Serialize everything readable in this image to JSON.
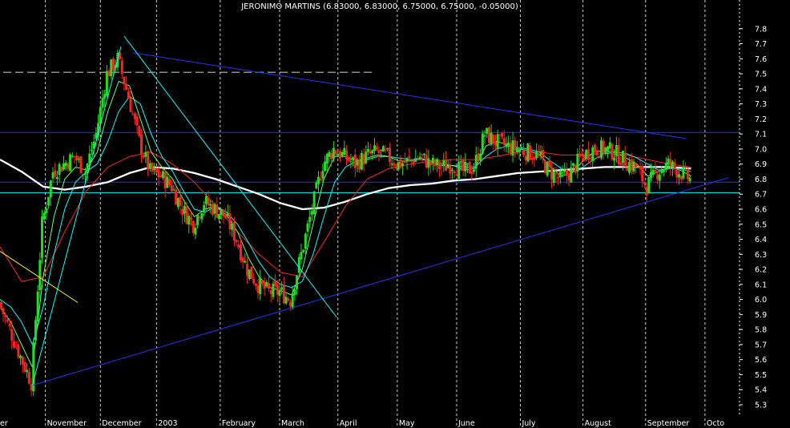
{
  "chart_data": {
    "type": "candlestick",
    "title": "JERONIMO MARTINS (6.83000, 6.83000, 6.75000, 6.75000, -0.05000)",
    "ylim": [
      5.22,
      7.9
    ],
    "y_ticks": [
      "5.3",
      "5.4",
      "5.5",
      "5.6",
      "5.7",
      "5.8",
      "5.9",
      "6.0",
      "6.1",
      "6.2",
      "6.3",
      "6.4",
      "6.5",
      "6.6",
      "6.7",
      "6.8",
      "6.9",
      "7.0",
      "7.1",
      "7.2",
      "7.3",
      "7.4",
      "7.5",
      "7.6",
      "7.7",
      "7.8"
    ],
    "x_ticks": [
      {
        "label": "er",
        "week": 0
      },
      {
        "label": "November",
        "week": 4.2
      },
      {
        "label": "December",
        "week": 9.3
      },
      {
        "label": "2003",
        "week": 14.5
      },
      {
        "label": "February",
        "week": 20.4
      },
      {
        "label": "March",
        "week": 25.9
      },
      {
        "label": "April",
        "week": 31.3
      },
      {
        "label": "May",
        "week": 36.8
      },
      {
        "label": "June",
        "week": 42.3
      },
      {
        "label": "July",
        "week": 48.2
      },
      {
        "label": "August",
        "week": 54.0
      },
      {
        "label": "September",
        "week": 59.8
      },
      {
        "label": "Octo",
        "week": 65.3
      }
    ],
    "week_range": [
      0,
      68.5
    ],
    "grid": "vertical-dashed",
    "horizontal_levels": [
      {
        "value": 7.11,
        "color": "#2233ff"
      },
      {
        "value": 6.78,
        "color": "#2233ff"
      },
      {
        "value": 6.71,
        "color": "#00ffff"
      }
    ],
    "dashed_level": {
      "value": 7.51,
      "x_from": 0.3,
      "x_to": 34.5,
      "color": "#bbbbbb"
    },
    "trendlines": [
      {
        "color": "#2233ff",
        "from": [
          3.0,
          5.43
        ],
        "to": [
          67.5,
          6.81
        ]
      },
      {
        "color": "#2233ff",
        "from": [
          12.3,
          7.64
        ],
        "to": [
          63.5,
          7.07
        ]
      },
      {
        "color": "#00ffff",
        "from": [
          11.5,
          7.75
        ],
        "to": [
          31.2,
          5.88
        ]
      },
      {
        "color": "#00ffff",
        "from": [
          3.0,
          5.43
        ],
        "to": [
          11.2,
          7.68
        ]
      },
      {
        "color": "#ffff00",
        "from": [
          0,
          6.32
        ],
        "to": [
          7.2,
          5.98
        ]
      }
    ],
    "series": [
      {
        "name": "",
        "kind": "price",
        "color": "#ffffff",
        "x": [
          0,
          1,
          2,
          3,
          4,
          5,
          6,
          7,
          8,
          9,
          10,
          11,
          12,
          13,
          14,
          15,
          16,
          17,
          18,
          19,
          20,
          21,
          22,
          23,
          24,
          25,
          26,
          27,
          28,
          29,
          30,
          31,
          32,
          33,
          34,
          35,
          36,
          37,
          38,
          39,
          40,
          41,
          42,
          43,
          44,
          45,
          46,
          47,
          48,
          49,
          50,
          51,
          52,
          53,
          54,
          55,
          56,
          57,
          58,
          59,
          60,
          61,
          62,
          63,
          64
        ],
        "y": [
          5.98,
          5.8,
          5.62,
          5.45,
          6.5,
          6.85,
          6.9,
          6.95,
          6.85,
          7.1,
          7.5,
          7.6,
          7.35,
          7.05,
          6.85,
          6.82,
          6.75,
          6.6,
          6.5,
          6.65,
          6.6,
          6.55,
          6.4,
          6.2,
          6.1,
          6.05,
          6.05,
          6.0,
          6.3,
          6.6,
          6.9,
          7.0,
          6.95,
          6.9,
          6.95,
          6.98,
          6.95,
          6.9,
          6.92,
          6.95,
          6.9,
          6.88,
          6.9,
          6.85,
          6.88,
          7.1,
          7.05,
          7.02,
          7.0,
          6.98,
          6.95,
          6.85,
          6.8,
          6.85,
          6.95,
          7.0,
          7.0,
          6.98,
          6.92,
          6.88,
          6.75,
          6.85,
          6.9,
          6.85,
          6.8
        ]
      },
      {
        "name": "",
        "kind": "ma",
        "color": "#ffffff",
        "width": 2.3,
        "x": [
          0,
          2,
          4,
          6,
          8,
          10,
          12,
          14,
          16,
          18,
          20,
          22,
          24,
          26,
          28,
          30,
          32,
          34,
          36,
          38,
          40,
          42,
          44,
          46,
          48,
          50,
          52,
          54,
          56,
          58,
          60,
          62,
          64
        ],
        "y": [
          6.93,
          6.85,
          6.75,
          6.73,
          6.75,
          6.78,
          6.84,
          6.88,
          6.87,
          6.84,
          6.8,
          6.75,
          6.7,
          6.64,
          6.6,
          6.61,
          6.65,
          6.7,
          6.74,
          6.76,
          6.77,
          6.79,
          6.8,
          6.82,
          6.84,
          6.85,
          6.86,
          6.87,
          6.88,
          6.88,
          6.88,
          6.88,
          6.87
        ]
      },
      {
        "name": "",
        "kind": "ma",
        "color": "#ff2222",
        "width": 1,
        "x": [
          0,
          2,
          4,
          6,
          8,
          10,
          12,
          14,
          16,
          18,
          20,
          22,
          24,
          26,
          28,
          30,
          32,
          34,
          36,
          38,
          40,
          42,
          44,
          46,
          48,
          50,
          52,
          54,
          56,
          58,
          60,
          62,
          64
        ],
        "y": [
          6.35,
          6.12,
          6.15,
          6.45,
          6.72,
          6.88,
          6.95,
          6.98,
          6.9,
          6.78,
          6.62,
          6.45,
          6.3,
          6.18,
          6.15,
          6.38,
          6.62,
          6.8,
          6.87,
          6.9,
          6.92,
          6.93,
          6.93,
          6.95,
          6.98,
          6.98,
          6.96,
          6.96,
          6.97,
          6.96,
          6.93,
          6.9,
          6.88
        ]
      },
      {
        "name": "",
        "kind": "ma",
        "color": "#00ffff",
        "width": 1,
        "x": [
          0,
          1,
          2,
          3,
          4,
          5,
          6,
          7,
          8,
          9,
          10,
          11,
          12,
          13,
          14,
          15,
          16,
          17,
          18,
          19,
          20,
          21,
          22,
          23,
          24,
          25,
          26,
          27,
          28,
          29,
          30,
          31,
          32,
          33,
          34,
          35,
          36,
          37,
          38,
          39,
          40,
          41,
          42,
          43,
          44,
          45,
          46,
          47,
          48,
          49,
          50,
          51,
          52,
          53,
          54,
          55,
          56,
          57,
          58,
          59,
          60,
          61,
          62,
          63,
          64
        ],
        "y": [
          6.0,
          5.95,
          5.85,
          5.7,
          5.95,
          6.3,
          6.6,
          6.78,
          6.85,
          6.9,
          7.05,
          7.25,
          7.35,
          7.3,
          7.1,
          6.95,
          6.85,
          6.72,
          6.6,
          6.58,
          6.62,
          6.58,
          6.5,
          6.38,
          6.25,
          6.15,
          6.1,
          6.08,
          6.12,
          6.3,
          6.55,
          6.78,
          6.88,
          6.92,
          6.93,
          6.95,
          6.95,
          6.94,
          6.93,
          6.93,
          6.92,
          6.9,
          6.89,
          6.88,
          6.88,
          6.95,
          7.0,
          7.02,
          7.01,
          7.0,
          6.98,
          6.92,
          6.87,
          6.85,
          6.88,
          6.93,
          6.97,
          6.98,
          6.97,
          6.94,
          6.9,
          6.86,
          6.87,
          6.87,
          6.85
        ]
      },
      {
        "name": "",
        "kind": "ma",
        "color": "#66ff66",
        "width": 1,
        "x": [
          0,
          1,
          2,
          3,
          4,
          5,
          6,
          7,
          8,
          9,
          10,
          11,
          12,
          13,
          14,
          15,
          16,
          17,
          18,
          19,
          20,
          21,
          22,
          23,
          24,
          25,
          26,
          27,
          28,
          29,
          30,
          31,
          32,
          33,
          34,
          35,
          36,
          37,
          38,
          39,
          40,
          41,
          42,
          43,
          44,
          45,
          46,
          47,
          48,
          49,
          50,
          51,
          52,
          53,
          54,
          55,
          56,
          57,
          58,
          59,
          60,
          61,
          62,
          63,
          64
        ],
        "y": [
          5.95,
          5.85,
          5.7,
          5.55,
          6.15,
          6.55,
          6.8,
          6.88,
          6.86,
          6.98,
          7.25,
          7.45,
          7.42,
          7.2,
          6.98,
          6.88,
          6.8,
          6.66,
          6.55,
          6.6,
          6.62,
          6.56,
          6.45,
          6.28,
          6.15,
          6.08,
          6.06,
          6.03,
          6.2,
          6.5,
          6.8,
          6.95,
          6.95,
          6.92,
          6.94,
          6.96,
          6.95,
          6.92,
          6.92,
          6.94,
          6.91,
          6.89,
          6.89,
          6.86,
          6.87,
          7.02,
          7.05,
          7.03,
          7.0,
          6.99,
          6.96,
          6.88,
          6.82,
          6.84,
          6.92,
          6.98,
          6.99,
          6.98,
          6.94,
          6.9,
          6.82,
          6.85,
          6.88,
          6.86,
          6.82
        ]
      }
    ]
  }
}
